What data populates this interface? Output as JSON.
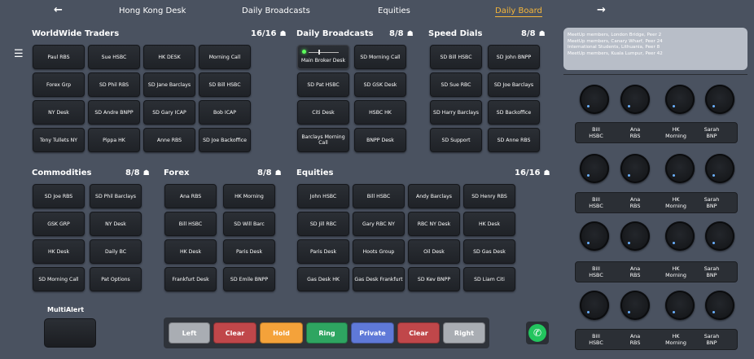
{
  "nav": {
    "back": "←",
    "forward": "→",
    "tabs": [
      "Hong Kong Desk",
      "Daily Broadcasts",
      "Equities",
      "Daily Board"
    ]
  },
  "menu_icon": "☰",
  "people_icon": "☗",
  "groups": {
    "worldwide": {
      "title": "WorldWide Traders",
      "count": "16/16",
      "buttons": [
        "Paul RBS",
        "Sue HSBC",
        "HK DESK",
        "Morning Call",
        "Forex Grp",
        "SD Phil RBS",
        "SD Jane Barclays",
        "SD Bill HSBC",
        "NY Desk",
        "SD Andre BNPP",
        "SD Gary ICAP",
        "Bob ICAP",
        "Tony Tullets NY",
        "Pippa HK",
        "Anne RBS",
        "SD Joe Backoffice"
      ]
    },
    "daily": {
      "title": "Daily Broadcasts",
      "count": "8/8",
      "buttons": [
        "Main Broker Desk",
        "SD Morning Call",
        "SD Pat HSBC",
        "SD GSK Desk",
        "Citi Desk",
        "HSBC HK",
        "Barclays Morning Call",
        "BNPP Desk"
      ]
    },
    "speed": {
      "title": "Speed Dials",
      "count": "8/8",
      "buttons": [
        "SD Bill HSBC",
        "SD John BNPP",
        "SD Sue RBC",
        "SD Joe Barclays",
        "SD Harry Barclays",
        "SD Backoffice",
        "SD Support",
        "SD Anne RBS"
      ]
    },
    "commodities": {
      "title": "Commodities",
      "count": "8/8",
      "buttons": [
        "SD Joe RBS",
        "SD Phil Barclays",
        "GSK GRP",
        "NY Desk",
        "HK Desk",
        "Daily BC",
        "SD Morning Call",
        "Pat Options"
      ]
    },
    "forex": {
      "title": "Forex",
      "count": "8/8",
      "buttons": [
        "Ana RBS",
        "HK Morning",
        "Bill HSBC",
        "SD Will Barc",
        "HK Desk",
        "Paris Desk",
        "Frankfurt Desk",
        "SD Emile BNPP"
      ]
    },
    "equities": {
      "title": "Equities",
      "count": "16/16",
      "buttons": [
        "John HSBC",
        "Bill HSBC",
        "Andy Barclays",
        "SD Henry RBS",
        "SD Jill RBC",
        "Gary RBC NY",
        "RBC NY Desk",
        "HK Desk",
        "Paris Desk",
        "Hoots Group",
        "Oil Desk",
        "SD Gas Desk",
        "Gas Desk HK",
        "Gas Desk Frankfurt",
        "SD Kev BNPP",
        "SD Liam Citi"
      ]
    }
  },
  "multialert": {
    "label": "MultiAlert"
  },
  "actions": [
    {
      "label": "Left",
      "color": "#a9adb3",
      "text": "#ffffff"
    },
    {
      "label": "Clear",
      "color": "#c0474a",
      "text": "#ffffff"
    },
    {
      "label": "Hold",
      "color": "#f4a23a",
      "text": "#ffffff"
    },
    {
      "label": "Ring",
      "color": "#2ea561",
      "text": "#ffffff"
    },
    {
      "label": "Private",
      "color": "#5f79d8",
      "text": "#ffffff"
    },
    {
      "label": "Clear",
      "color": "#c0474a",
      "text": "#ffffff"
    },
    {
      "label": "Right",
      "color": "#a9adb3",
      "text": "#ffffff"
    }
  ],
  "phone_icon": "✆",
  "info": {
    "lines": [
      "MeetUp members, London Bridge, Peer 2",
      "MeetUp members, Canary Wharf, Peer 24",
      "International Students, Lithuania, Peer 8",
      "MeetUp members, Kuala Lumpur, Peer 42"
    ]
  },
  "knob_labels": [
    [
      "Bill HSBC",
      "Ana RBS",
      "HK Morning",
      "Sarah BNP"
    ],
    [
      "Bill HSBC",
      "Ana RBS",
      "HK Morning",
      "Sarah BNP"
    ],
    [
      "Bill HSBC",
      "Ana RBS",
      "HK Morning",
      "Sarah BNP"
    ],
    [
      "Bill HSBC",
      "Ana RBS",
      "HK Morning",
      "Sarah BNP"
    ]
  ],
  "colors": {
    "background": "#4a5260",
    "active_tab": "#f5b63a",
    "led": "#5cff5c",
    "phone": "#22c55e"
  }
}
